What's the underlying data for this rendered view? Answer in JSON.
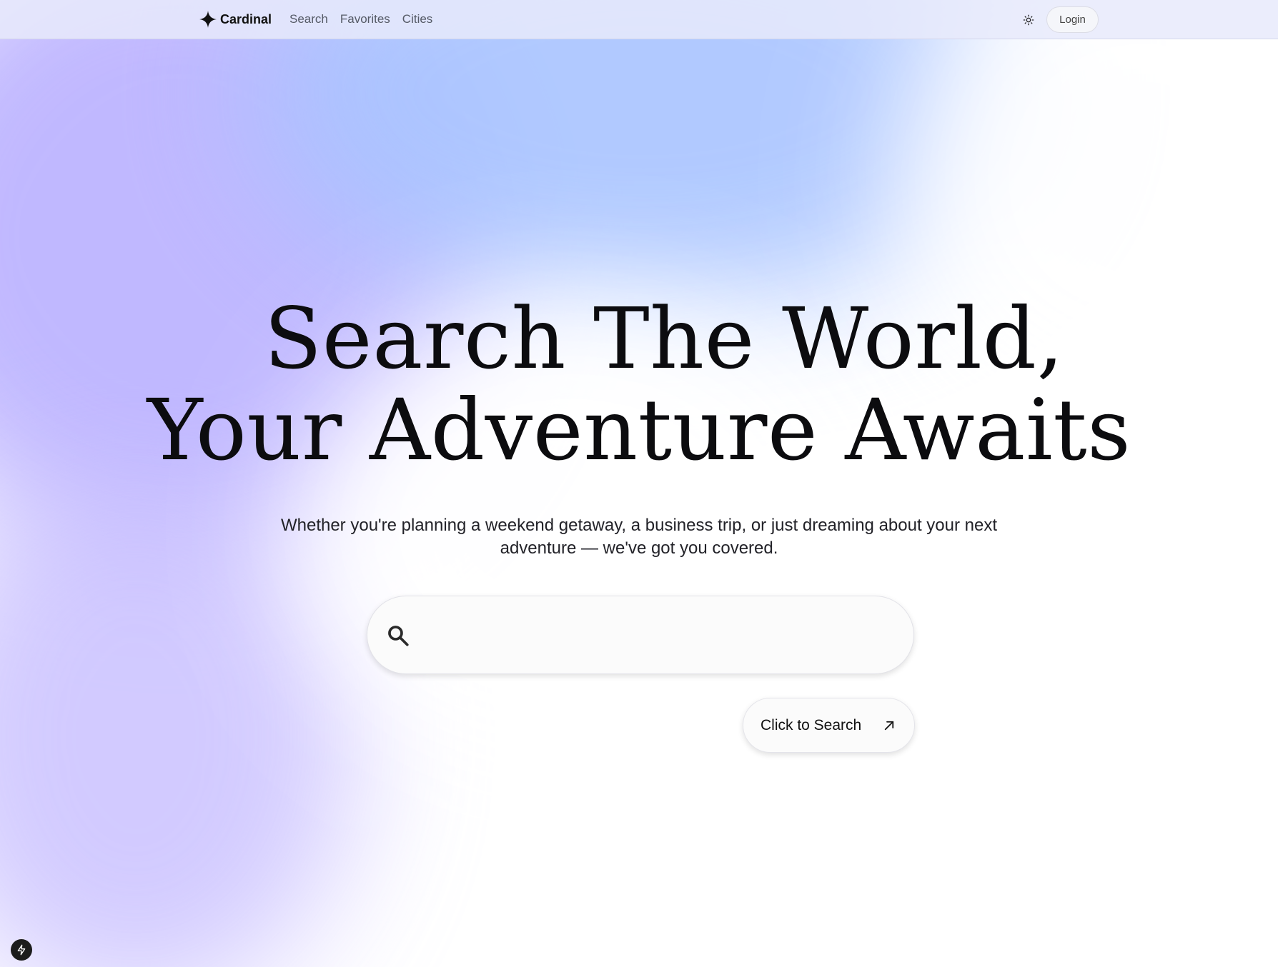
{
  "nav": {
    "brand": "Cardinal",
    "links": [
      "Search",
      "Favorites",
      "Cities"
    ],
    "login_label": "Login",
    "theme_icon": "sun-icon"
  },
  "hero": {
    "title_line1": "Search The World,",
    "title_line2": "Your Adventure Awaits",
    "subtitle": "Whether you're planning a weekend getaway, a business trip, or just dreaming about your next adventure — we've got you covered."
  },
  "search": {
    "value": "",
    "placeholder": "",
    "icon": "search-icon"
  },
  "cta": {
    "label": "Click to Search",
    "icon": "arrow-up-right-icon"
  },
  "colors": {
    "text": "#111111",
    "accent_purple": "#b6acff",
    "accent_blue": "#a9c4ff",
    "badge": "#1c1c1c"
  }
}
